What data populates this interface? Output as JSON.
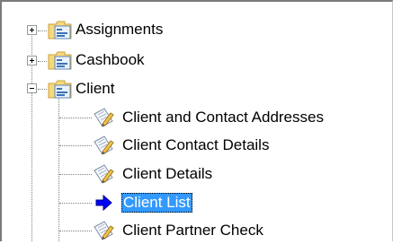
{
  "tree": {
    "items": [
      {
        "label": "Assignments",
        "expanded": false,
        "icon": "folder-form-icon"
      },
      {
        "label": "Cashbook",
        "expanded": false,
        "icon": "folder-form-icon"
      },
      {
        "label": "Client",
        "expanded": true,
        "icon": "folder-form-icon",
        "children": [
          {
            "label": "Client and Contact Addresses",
            "icon": "report-pencil-icon"
          },
          {
            "label": "Client Contact Details",
            "icon": "report-pencil-icon"
          },
          {
            "label": "Client Details",
            "icon": "report-pencil-icon"
          },
          {
            "label": "Client List",
            "icon": "blue-arrow-icon",
            "selected": true
          },
          {
            "label": "Client Partner Check",
            "icon": "report-pencil-icon"
          }
        ]
      }
    ]
  },
  "colors": {
    "selection": "#3399ff",
    "arrow": "#0000ff"
  }
}
